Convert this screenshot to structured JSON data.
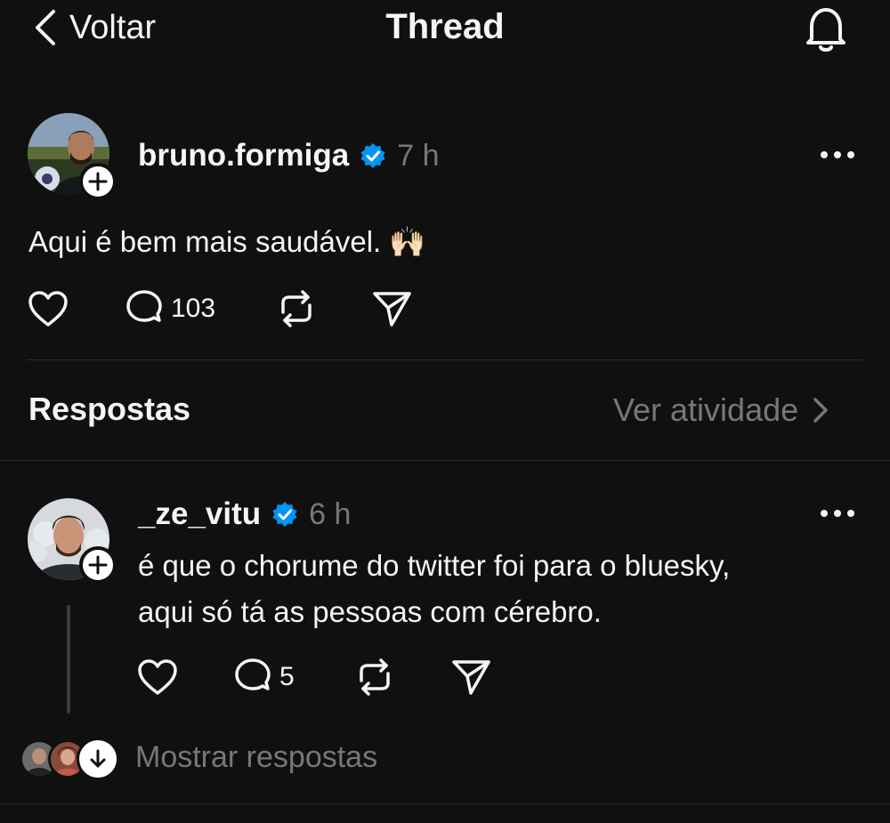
{
  "header": {
    "back_label": "Voltar",
    "title": "Thread",
    "notification_icon": "bell-icon"
  },
  "post": {
    "username": "bruno.formiga",
    "time": "7 h",
    "text": "Aqui é bem mais saudável. 🙌🏻",
    "reply_count": "103",
    "verified": true
  },
  "replies_section": {
    "title": "Respostas",
    "activity_label": "Ver atividade"
  },
  "reply": {
    "username": "_ze_vitu",
    "time": "6 h",
    "text_line1": "é que o chorume do twitter foi para o bluesky,",
    "text_line2": "aqui só tá as pessoas com cérebro.",
    "reply_count": "5",
    "verified": true
  },
  "show_replies": {
    "label": "Mostrar respostas"
  },
  "colors": {
    "background": "#101010",
    "text": "#f3f5f7",
    "secondary_text": "#777777",
    "verified_blue": "#0095f6",
    "divider": "#2c2c2c"
  }
}
